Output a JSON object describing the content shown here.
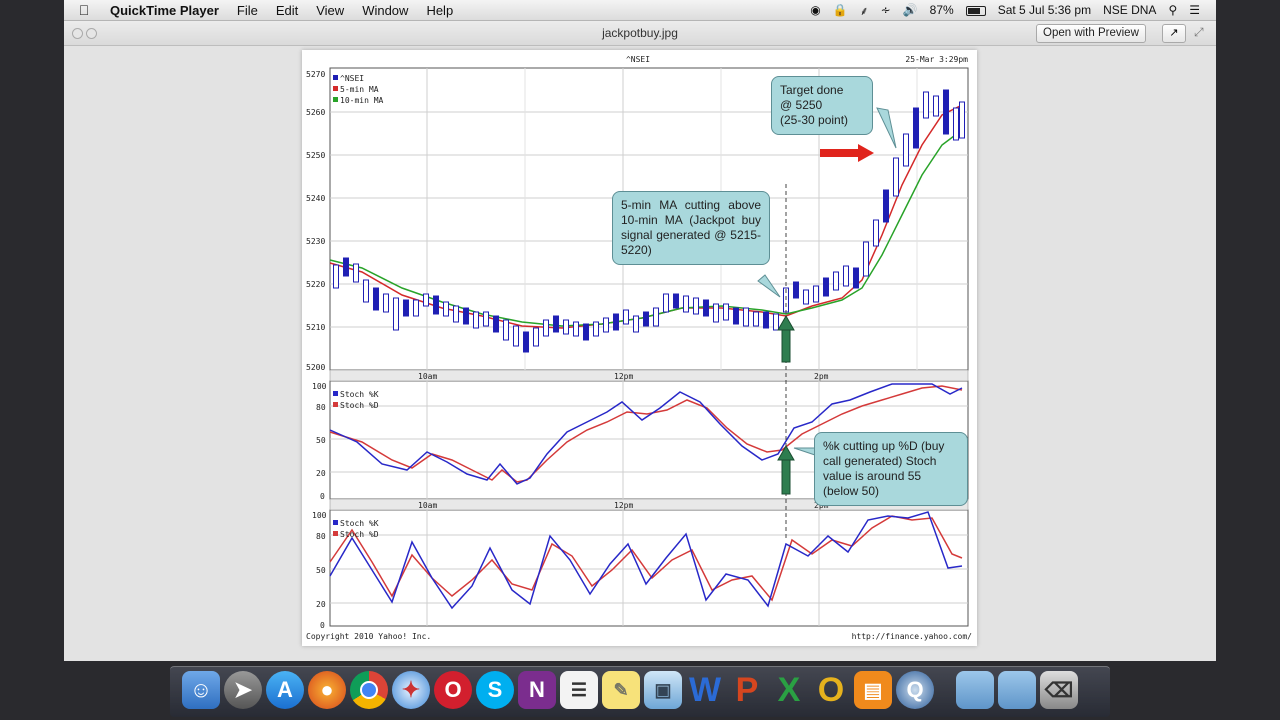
{
  "menubar": {
    "app": "QuickTime Player",
    "items": [
      "File",
      "Edit",
      "View",
      "Window",
      "Help"
    ],
    "battery": "87%",
    "clock": "Sat 5 Jul  5:36 pm",
    "user": "NSE DNA"
  },
  "window": {
    "title": "jackpotbuy.jpg",
    "open_with_preview": "Open with Preview"
  },
  "chart": {
    "title": "^NSEI",
    "timestamp": "25-Mar 3:29pm",
    "copyright": "Copyright 2010 Yahoo! Inc.",
    "source": "http://finance.yahoo.com/",
    "price_legend": [
      "^NSEI",
      "5-min MA",
      "10-min MA"
    ],
    "stoch_legend": [
      "Stoch %K",
      "Stoch %D"
    ],
    "price_axis": [
      "5270",
      "5260",
      "5250",
      "5240",
      "5230",
      "5220",
      "5210",
      "5200"
    ],
    "stoch_axis": [
      "100",
      "80",
      "50",
      "20",
      "0"
    ],
    "time_labels": [
      "10am",
      "12pm",
      "2pm"
    ],
    "colors": {
      "price": "#1f1fb4",
      "ma5": "#d42a2a",
      "ma10": "#29a329",
      "k": "#2828c8",
      "d": "#d43a3a"
    }
  },
  "callouts": {
    "target": [
      "Target done",
      "@ 5250",
      "(25-30 point)"
    ],
    "ma_cross": "5-min MA cutting above 10-min MA (Jackpot buy signal generated @ 5215-5220)",
    "stoch": "%k cutting up %D (buy call generated) Stoch value is around 55 (below 50)"
  },
  "dock": {
    "apps": [
      "finder-icon",
      "launchpad-icon",
      "appstore-icon",
      "firefox-icon",
      "chrome-icon",
      "safari-icon",
      "opera-icon",
      "skype-icon",
      "onenote-icon",
      "notes-icon",
      "stickies-icon",
      "preview-icon",
      "word-icon",
      "powerpoint-icon",
      "excel-icon",
      "outlook-icon",
      "ibooks-icon",
      "quicktime-icon",
      "folder-icon",
      "downloads-icon",
      "trash-icon"
    ]
  }
}
